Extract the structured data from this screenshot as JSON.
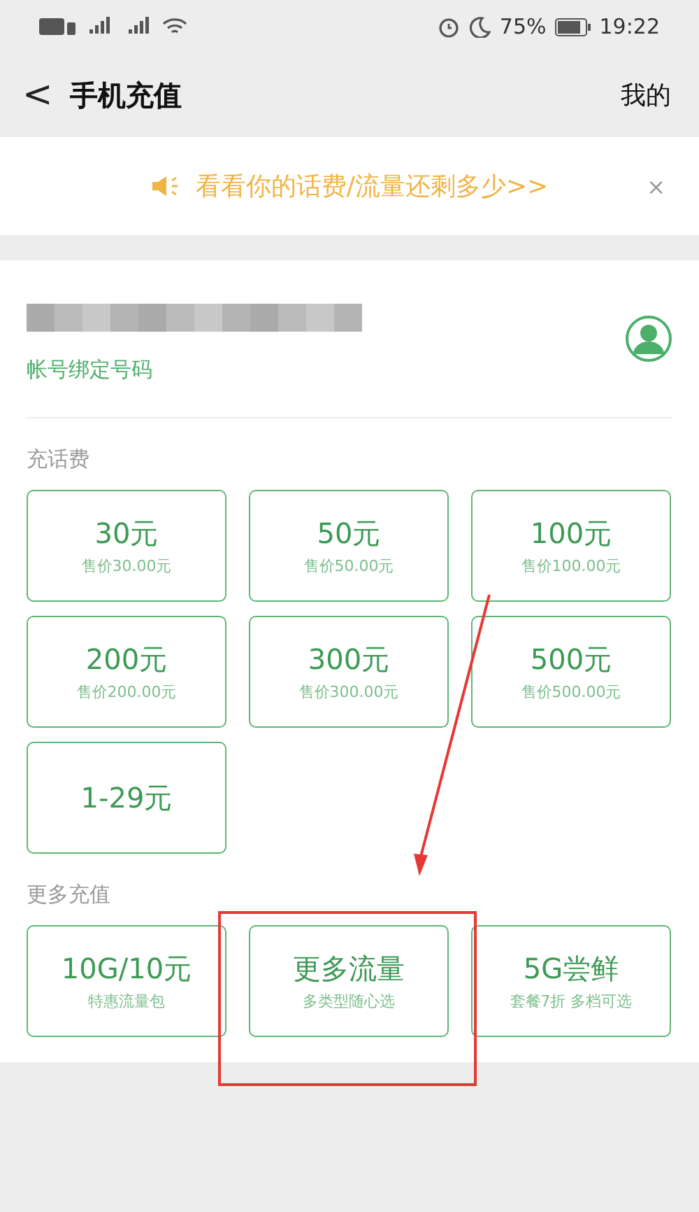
{
  "status_bar": {
    "battery_percent": "75%",
    "time": "19:22"
  },
  "header": {
    "back": "<",
    "title": "手机充值",
    "action": "我的"
  },
  "notice": {
    "text": "看看你的话费/流量还剩多少>>",
    "close": "×"
  },
  "account": {
    "label": "帐号绑定号码"
  },
  "sections": [
    {
      "title": "充话费",
      "items": [
        {
          "amount": "30元",
          "price": "售价30.00元"
        },
        {
          "amount": "50元",
          "price": "售价50.00元"
        },
        {
          "amount": "100元",
          "price": "售价100.00元"
        },
        {
          "amount": "200元",
          "price": "售价200.00元"
        },
        {
          "amount": "300元",
          "price": "售价300.00元"
        },
        {
          "amount": "500元",
          "price": "售价500.00元"
        },
        {
          "amount": "1-29元"
        }
      ]
    },
    {
      "title": "更多充值",
      "items": [
        {
          "amount": "10G/10元",
          "price": "特惠流量包"
        },
        {
          "amount": "更多流量",
          "price": "多类型随心选"
        },
        {
          "amount": "5G尝鲜",
          "price": "套餐7折 多档可选"
        }
      ]
    }
  ]
}
